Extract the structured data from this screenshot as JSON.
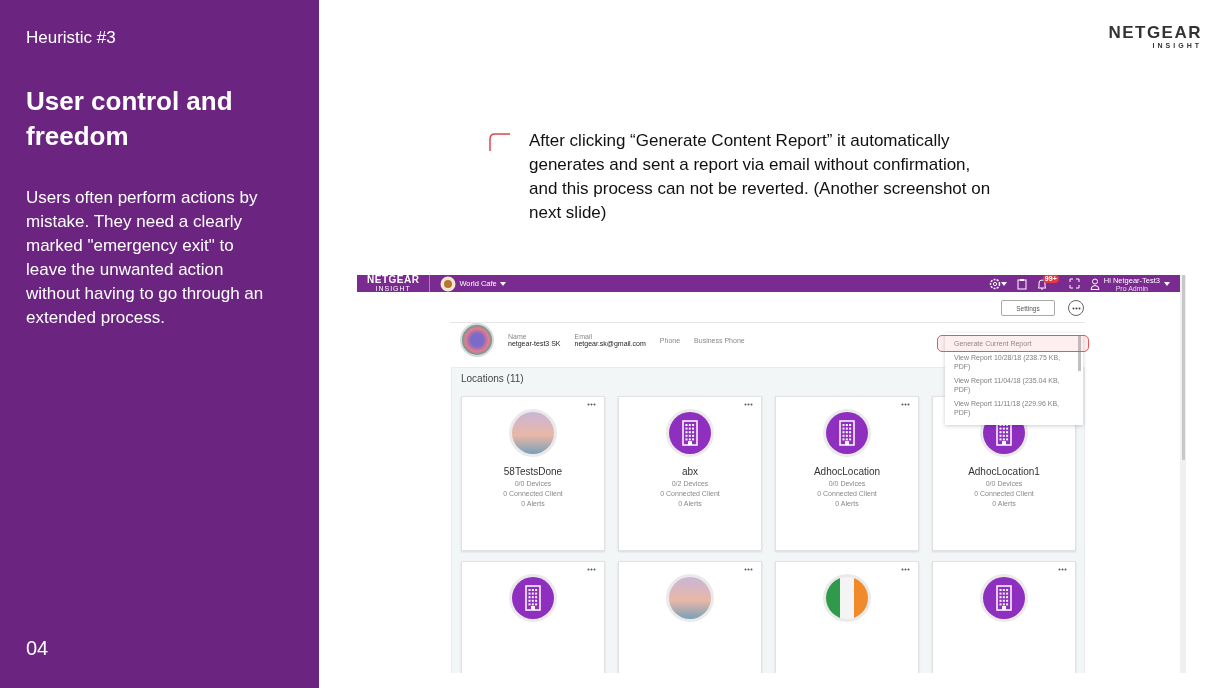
{
  "sidebar": {
    "kicker": "Heuristic #3",
    "title": "User control and freedom",
    "body": "Users often perform actions by mistake. They need a clearly marked \"emergency exit\" to leave the unwanted action without having to go through an extended process.",
    "page_number": "04"
  },
  "brand": {
    "name": "NETGEAR",
    "sub": "INSIGHT"
  },
  "note": "After clicking “Generate Content Report” it automatically generates and sent a report via email without confirmation, and this process can not be reverted. (Another screenshot on next slide)",
  "app": {
    "topbar": {
      "logo": "NETGEAR",
      "logo_sub": "INSIGHT",
      "location": "World Cafe",
      "badge": "99+",
      "greeting": "Hi Netgear-Test3",
      "role": "Pro Admin"
    },
    "settings_button": "Settings",
    "profile": [
      {
        "label": "Name",
        "value": "netgear-test3 SK"
      },
      {
        "label": "Email",
        "value": "netgear.sk@gmail.com"
      },
      {
        "label": "Phone"
      },
      {
        "label": "Business Phone"
      }
    ],
    "menu": [
      {
        "label": "Generate Current Report",
        "highlighted": true
      },
      {
        "label": "View Report 10/28/18 (238.75 KB, PDF)",
        "highlighted": false
      },
      {
        "label": "View Report 11/04/18 (235.04 KB, PDF)",
        "highlighted": false
      },
      {
        "label": "View Report 11/11/18 (229.96 KB, PDF)",
        "highlighted": false
      }
    ],
    "locations_title": "Locations (11)",
    "cards": [
      {
        "kind": "photo",
        "name": "58TestsDone",
        "devices": "0/0 Devices",
        "clients": "0 Connected Client",
        "alerts": "0 Alerts"
      },
      {
        "kind": "building",
        "name": "abx",
        "devices": "0/2 Devices",
        "clients": "0 Connected Client",
        "alerts": "0 Alerts"
      },
      {
        "kind": "building",
        "name": "AdhocLocation",
        "devices": "0/0 Devices",
        "clients": "0 Connected Client",
        "alerts": "0 Alerts"
      },
      {
        "kind": "building",
        "name": "AdhocLocation1",
        "devices": "0/0 Devices",
        "clients": "0 Connected Client",
        "alerts": "0 Alerts"
      },
      {
        "kind": "building"
      },
      {
        "kind": "photo"
      },
      {
        "kind": "flag"
      },
      {
        "kind": "building"
      }
    ]
  }
}
